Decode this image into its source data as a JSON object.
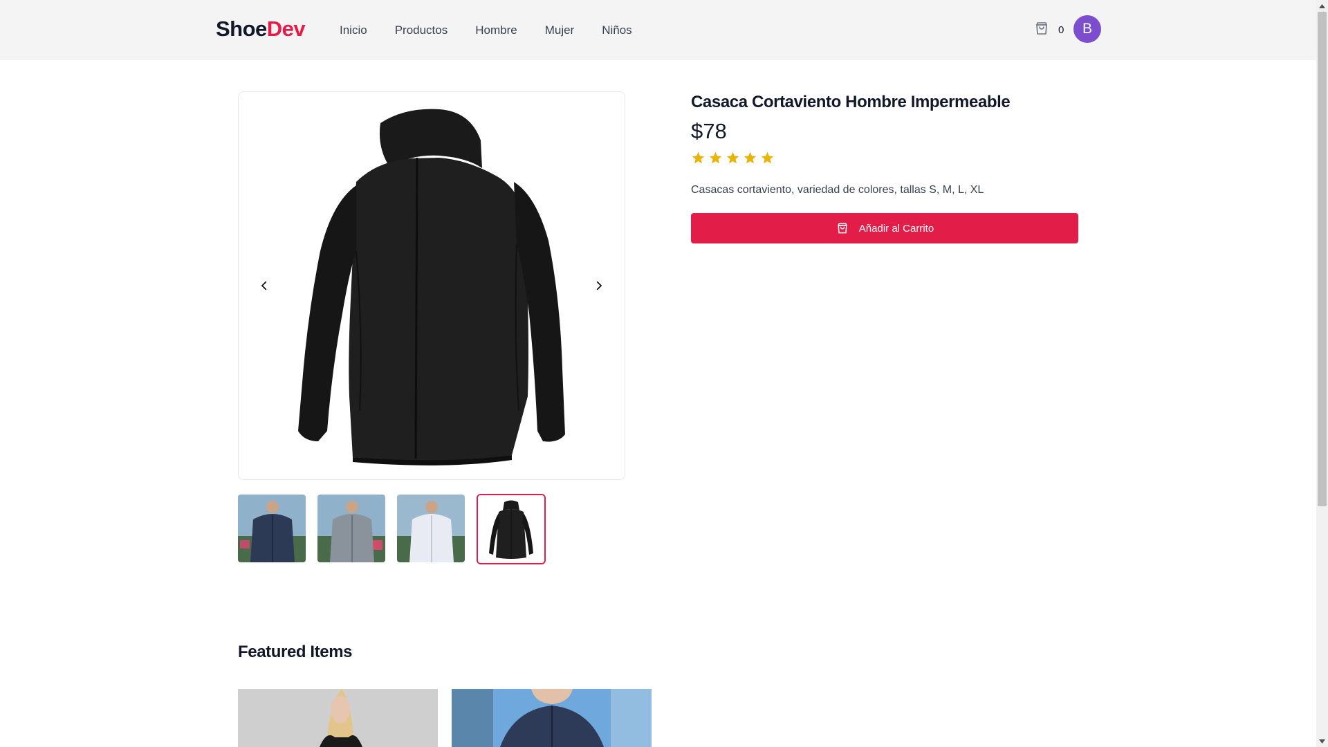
{
  "header": {
    "logo_part1": "Shoe",
    "logo_part2": "Dev",
    "nav": [
      "Inicio",
      "Productos",
      "Hombre",
      "Mujer",
      "Niños"
    ],
    "cart_count": "0",
    "avatar_initial": "B"
  },
  "product": {
    "title": "Casaca Cortaviento Hombre Impermeable",
    "price": "$78",
    "rating": 5,
    "rating_max": 5,
    "description": "Casacas cortaviento, variedad de colores, tallas S, M, L, XL",
    "add_to_cart_label": "Añadir al Carrito",
    "thumbnails": [
      "navy-jacket-thumbnail",
      "grey-jacket-thumbnail",
      "white-jacket-thumbnail",
      "black-jacket-thumbnail"
    ],
    "selected_thumbnail": 3
  },
  "featured": {
    "title": "Featured Items"
  },
  "colors": {
    "accent": "#e11d48",
    "star": "#eab308",
    "avatar": "#7c4dcc"
  }
}
